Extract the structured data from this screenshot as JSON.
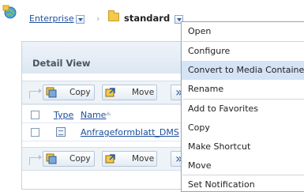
{
  "breadcrumb": {
    "root_label": "Enterprise",
    "current_label": "standard",
    "separator": "›"
  },
  "panel": {
    "title": "Detail View"
  },
  "toolbar": {
    "copy_label": "Copy",
    "move_label": "Move"
  },
  "table": {
    "columns": [
      "Type",
      "Name"
    ],
    "rows": [
      {
        "type_icon": "document-icon",
        "name": "Anfrageformblatt_DMS"
      }
    ]
  },
  "context_menu": {
    "items": [
      {
        "label": "Open",
        "highlighted": false
      },
      {
        "label": "Configure",
        "highlighted": false
      },
      {
        "label": "Convert to Media Container",
        "highlighted": true
      },
      {
        "label": "Rename",
        "highlighted": false
      },
      {
        "label": "Add to Favorites",
        "highlighted": false
      },
      {
        "label": "Copy",
        "highlighted": false
      },
      {
        "label": "Make Shortcut",
        "highlighted": false
      },
      {
        "label": "Move",
        "highlighted": false
      },
      {
        "label": "Set Notification",
        "highlighted": false
      }
    ]
  },
  "colors": {
    "link": "#1e4e9c",
    "menu_highlight": "#d5e3f6",
    "panel_header": "#dde7f2"
  }
}
